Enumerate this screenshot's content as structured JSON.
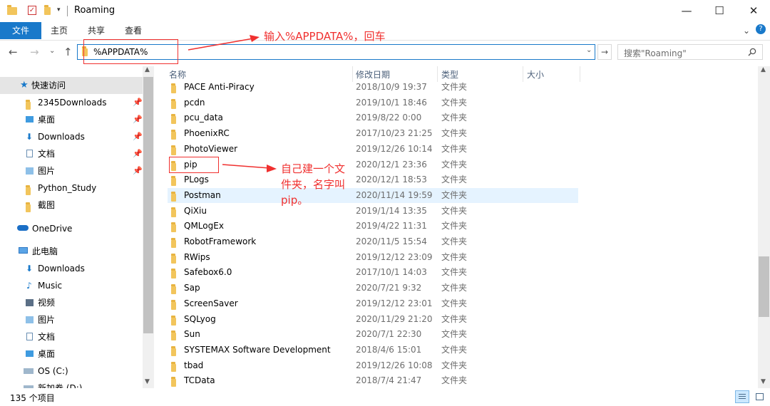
{
  "window": {
    "title": "Roaming",
    "buttons": {
      "minimize": "—",
      "maximize": "☐",
      "close": "✕"
    }
  },
  "ribbon": {
    "tabs": [
      "文件",
      "主页",
      "共享",
      "查看"
    ],
    "help": "?",
    "expand": "⌄"
  },
  "address": {
    "value": "%APPDATA%",
    "dropdown": "⌄",
    "go": "→"
  },
  "search": {
    "placeholder": "搜索\"Roaming\"",
    "icon": "search-icon"
  },
  "nav": {
    "back": "←",
    "forward": "→",
    "recent": "⌄",
    "up": "↑",
    "quick_access": "快速访问",
    "quick_items": [
      "2345Downloads",
      "桌面",
      "Downloads",
      "文档",
      "图片",
      "Python_Study",
      "截图"
    ],
    "onedrive": "OneDrive",
    "this_pc": "此电脑",
    "pc_items": [
      "Downloads",
      "Music",
      "视频",
      "图片",
      "文档",
      "桌面",
      "OS (C:)",
      "新加卷 (D:)"
    ]
  },
  "columns": {
    "name": "名称",
    "date": "修改日期",
    "type": "类型",
    "size": "大小"
  },
  "files": [
    {
      "name": "PACE Anti-Piracy",
      "date": "2018/10/9 19:37",
      "type": "文件夹"
    },
    {
      "name": "pcdn",
      "date": "2019/10/1 18:46",
      "type": "文件夹"
    },
    {
      "name": "pcu_data",
      "date": "2019/8/22 0:00",
      "type": "文件夹"
    },
    {
      "name": "PhoenixRC",
      "date": "2017/10/23 21:25",
      "type": "文件夹"
    },
    {
      "name": "PhotoViewer",
      "date": "2019/12/26 10:14",
      "type": "文件夹"
    },
    {
      "name": "pip",
      "date": "2020/12/1 23:36",
      "type": "文件夹"
    },
    {
      "name": "PLogs",
      "date": "2020/12/1 18:53",
      "type": "文件夹"
    },
    {
      "name": "Postman",
      "date": "2020/11/14 19:59",
      "type": "文件夹"
    },
    {
      "name": "QiXiu",
      "date": "2019/1/14 13:35",
      "type": "文件夹"
    },
    {
      "name": "QMLogEx",
      "date": "2019/4/22 11:31",
      "type": "文件夹"
    },
    {
      "name": "RobotFramework",
      "date": "2020/11/5 15:54",
      "type": "文件夹"
    },
    {
      "name": "RWips",
      "date": "2019/12/12 23:09",
      "type": "文件夹"
    },
    {
      "name": "Safebox6.0",
      "date": "2017/10/1 14:03",
      "type": "文件夹"
    },
    {
      "name": "Sap",
      "date": "2020/7/21 9:32",
      "type": "文件夹"
    },
    {
      "name": "ScreenSaver",
      "date": "2019/12/12 23:01",
      "type": "文件夹"
    },
    {
      "name": "SQLyog",
      "date": "2020/11/29 21:20",
      "type": "文件夹"
    },
    {
      "name": "Sun",
      "date": "2020/7/1 22:30",
      "type": "文件夹"
    },
    {
      "name": "SYSTEMAX Software Development",
      "date": "2018/4/6 15:01",
      "type": "文件夹"
    },
    {
      "name": "tbad",
      "date": "2019/12/26 10:08",
      "type": "文件夹"
    },
    {
      "name": "TCData",
      "date": "2018/7/4 21:47",
      "type": "文件夹"
    }
  ],
  "status": {
    "count": "135 个项目"
  },
  "annotations": {
    "address_note": "输入%APPDATA%，回车",
    "pip_note_line1": "自己建一个文",
    "pip_note_line2": "件夹，名字叫",
    "pip_note_line3": "pip。",
    "color": "#f0302f"
  },
  "colors": {
    "accent": "#1979ca",
    "folder": "#f2c55c",
    "selection": "#e5f3ff"
  }
}
